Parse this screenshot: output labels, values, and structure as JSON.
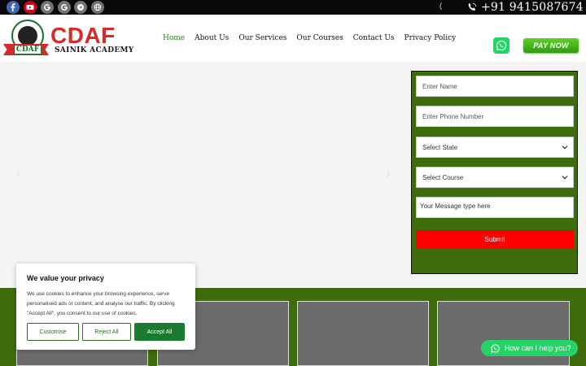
{
  "topbar": {
    "social": [
      {
        "name": "facebook-icon",
        "bg": "#4267b2"
      },
      {
        "name": "youtube-icon",
        "bg": "#d0021b"
      },
      {
        "name": "google-icon",
        "bg": "#737373"
      },
      {
        "name": "google-icon-2",
        "bg": "#737373"
      },
      {
        "name": "telegram-icon",
        "bg": "#737373"
      },
      {
        "name": "globe-icon",
        "bg": "#737373"
      }
    ],
    "mark": "(",
    "phone": "+91 9415087674"
  },
  "header": {
    "logo_badge": "CDAF",
    "brand_title": "CDAF",
    "brand_subtitle": "SAINIK ACADEMY",
    "nav": [
      "Home",
      "About Us",
      "Our Services",
      "Our Courses",
      "Contact Us",
      "Privacy Policy"
    ],
    "pay_label": "PAY NOW"
  },
  "hero": {
    "prev_arrow": "‹",
    "next_arrow": "›"
  },
  "form": {
    "name_placeholder": "Enter Name",
    "phone_placeholder": "Enter Phone Number",
    "state_label": "Select State",
    "course_label": "Select Course",
    "message_placeholder": "Your Message type here",
    "submit_label": "Submit"
  },
  "cookie": {
    "title": "We value your privacy",
    "body": "We use cookies to enhance your browsing experience, serve personalised ads or content, and analyse our traffic. By clicking \"Accept All\", you consent to our use of cookies.",
    "customise": "Customise",
    "reject": "Reject All",
    "accept": "Accept All"
  },
  "chat": {
    "label": "How can I help you?"
  },
  "colors": {
    "brand_red": "#d42a2a",
    "brand_green": "#3e6b0b",
    "whatsapp": "#25d366",
    "submit_red": "#ff0000"
  }
}
